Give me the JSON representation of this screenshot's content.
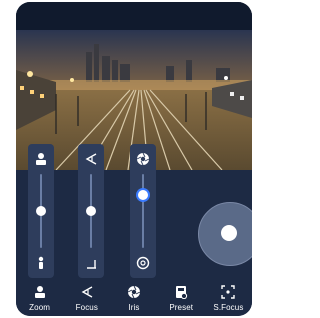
{
  "tabs": [
    {
      "label": "Zoom",
      "icon": "person-icon"
    },
    {
      "label": "Focus",
      "icon": "focus-angle-icon"
    },
    {
      "label": "Iris",
      "icon": "aperture-icon"
    },
    {
      "label": "Preset",
      "icon": "preset-icon"
    },
    {
      "label": "S.Focus",
      "icon": "smart-focus-icon"
    }
  ],
  "sliders": {
    "zoom": {
      "top_icon": "person-large-icon",
      "bottom_icon": "person-small-icon",
      "level": 0.5
    },
    "focus": {
      "top_icon": "focus-angle-icon",
      "bottom_icon": "focus-near-icon",
      "level": 0.5
    },
    "iris": {
      "top_icon": "aperture-open-icon",
      "bottom_icon": "aperture-closed-icon",
      "level": 0.72,
      "active": true
    }
  },
  "colors": {
    "panel_bg": "#1d2a44",
    "slider_panel": "#2e3d5c",
    "accent": "#3a7bff"
  }
}
